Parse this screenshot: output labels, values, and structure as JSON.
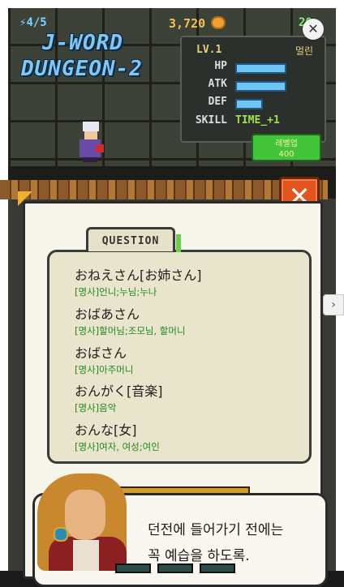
{
  "hud": {
    "energy": "4/5",
    "coins": "3,720",
    "gems": "20"
  },
  "title": {
    "line1": "J-WORD",
    "line2": "DUNGEON-2"
  },
  "stats": {
    "level": "LV.1",
    "name": "멀린",
    "hp_label": "HP",
    "atk_label": "ATK",
    "def_label": "DEF",
    "skill_label": "SKILL",
    "skill_value": "TIME_+1",
    "hp_fraction": 0.9,
    "atk_fraction": 0.9,
    "def_fraction": 0.45
  },
  "levelup": {
    "label": "레벨업",
    "cost": "400"
  },
  "question": {
    "tab_label": "QUESTION",
    "entries": [
      {
        "jp": "おねえさん[お姉さん]",
        "kr": "[명사]언니;누님;누나"
      },
      {
        "jp": "おばあさん",
        "kr": "[명사]할머님;조모님, 할머니"
      },
      {
        "jp": "おばさん",
        "kr": "[명사]아주머니"
      },
      {
        "jp": "おんがく[音楽]",
        "kr": "[명사]음악"
      },
      {
        "jp": "おんな[女]",
        "kr": "[명사]여자, 여성;여인"
      }
    ]
  },
  "dialog": {
    "line1": "던전에 들어가기 전에는",
    "line2": "꼭 예습을 하도록."
  },
  "icons": {
    "energy": "lightning-icon",
    "coins": "coin-stack-icon",
    "gems": "gem-icon",
    "exit": "close-icon",
    "overlay_close": "close-icon",
    "side": "chevron-right-icon"
  },
  "colors": {
    "accent_blue": "#6ec4f5",
    "green_text": "#1f8a1f",
    "exit_orange": "#e2551e"
  }
}
